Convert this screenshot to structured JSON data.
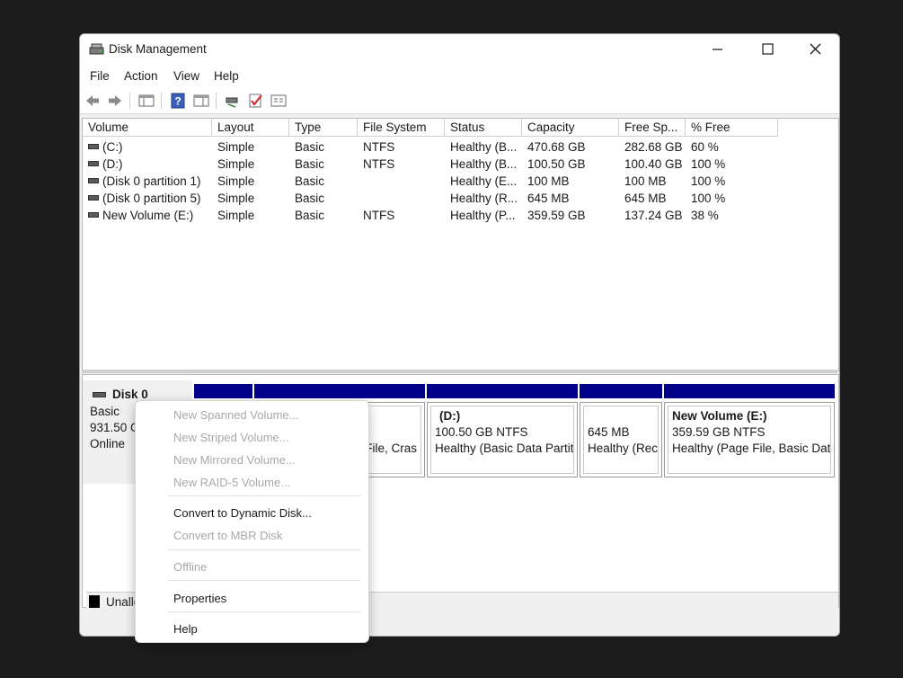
{
  "window": {
    "title": "Disk Management"
  },
  "menu": [
    "File",
    "Action",
    "View",
    "Help"
  ],
  "toolbar": [
    "back-icon",
    "forward-icon",
    "console-tree-icon",
    "help-icon",
    "properties-icon",
    "connect-icon",
    "checkmark-icon",
    "settings-icon"
  ],
  "columns": [
    "Volume",
    "Layout",
    "Type",
    "File System",
    "Status",
    "Capacity",
    "Free Sp...",
    "% Free"
  ],
  "volumes": [
    {
      "volume": "(C:)",
      "layout": "Simple",
      "type": "Basic",
      "fs": "NTFS",
      "status": "Healthy (B...",
      "capacity": "470.68 GB",
      "free": "282.68 GB",
      "pct": "60 %"
    },
    {
      "volume": "(D:)",
      "layout": "Simple",
      "type": "Basic",
      "fs": "NTFS",
      "status": "Healthy (B...",
      "capacity": "100.50 GB",
      "free": "100.40 GB",
      "pct": "100 %"
    },
    {
      "volume": "(Disk 0 partition 1)",
      "layout": "Simple",
      "type": "Basic",
      "fs": "",
      "status": "Healthy (E...",
      "capacity": "100 MB",
      "free": "100 MB",
      "pct": "100 %"
    },
    {
      "volume": "(Disk 0 partition 5)",
      "layout": "Simple",
      "type": "Basic",
      "fs": "",
      "status": "Healthy (R...",
      "capacity": "645 MB",
      "free": "645 MB",
      "pct": "100 %"
    },
    {
      "volume": "New Volume (E:)",
      "layout": "Simple",
      "type": "Basic",
      "fs": "NTFS",
      "status": "Healthy (P...",
      "capacity": "359.59 GB",
      "free": "137.24 GB",
      "pct": "38 %"
    }
  ],
  "disk": {
    "name": "Disk 0",
    "type": "Basic",
    "size": "931.50 G",
    "state": "Online",
    "partitions": [
      {
        "title": "",
        "line1": "",
        "line2": ""
      },
      {
        "title": "",
        "line1": "",
        "line2": "File, Cras"
      },
      {
        "title": "(D:)",
        "line1": "100.50 GB NTFS",
        "line2": "Healthy (Basic Data Partiti"
      },
      {
        "title": "",
        "line1": "645 MB",
        "line2": "Healthy (Rec"
      },
      {
        "title": "New Volume  (E:)",
        "line1": "359.59 GB NTFS",
        "line2": "Healthy (Page File, Basic Data"
      }
    ]
  },
  "legend": {
    "unallocated": "Unallo"
  },
  "context_menu": {
    "new_spanned": "New Spanned Volume...",
    "new_striped": "New Striped Volume...",
    "new_mirrored": "New Mirrored Volume...",
    "new_raid5": "New RAID-5 Volume...",
    "convert_dynamic": "Convert to Dynamic Disk...",
    "convert_mbr": "Convert to MBR Disk",
    "offline": "Offline",
    "properties": "Properties",
    "help": "Help"
  },
  "colors": {
    "partition_bar": "#00008b",
    "background": "#1c1c1c"
  }
}
